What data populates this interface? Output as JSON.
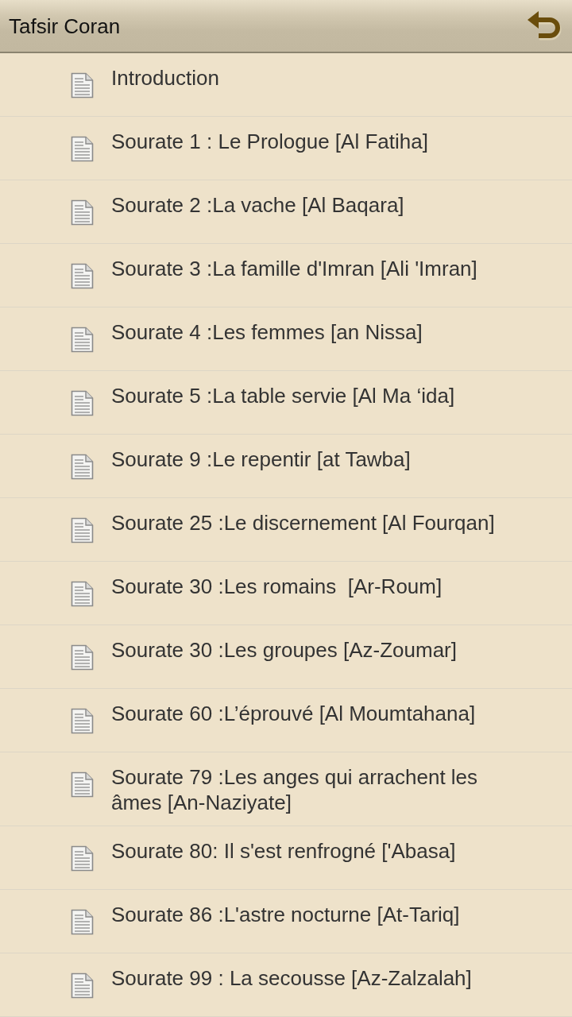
{
  "app_bar": {
    "title": "Tafsir Coran"
  },
  "items": [
    {
      "label": "Introduction"
    },
    {
      "label": "Sourate 1 : Le Prologue [Al Fatiha]"
    },
    {
      "label": "Sourate 2 :La vache [Al Baqara]"
    },
    {
      "label": "Sourate 3 :La famille d'Imran [Ali 'Imran]"
    },
    {
      "label": "Sourate 4 :Les femmes [an Nissa]"
    },
    {
      "label": "Sourate 5 :La table servie [Al Ma ‘ida]"
    },
    {
      "label": "Sourate 9 :Le repentir [at Tawba]"
    },
    {
      "label": "Sourate 25 :Le discernement [Al Fourqan]"
    },
    {
      "label": "Sourate 30 :Les romains  [Ar-Roum]"
    },
    {
      "label": "Sourate 30 :Les groupes [Az-Zoumar]"
    },
    {
      "label": "Sourate 60 :L’éprouvé [Al Moumtahana]"
    },
    {
      "label": "Sourate 79 :Les anges qui arrachent les âmes [An-Naziyate]"
    },
    {
      "label": "Sourate 80: Il s'est renfrogné ['Abasa]"
    },
    {
      "label": "Sourate 86 :L'astre nocturne [At-Tariq]"
    },
    {
      "label": "Sourate 99 : La secousse [Az-Zalzalah]"
    }
  ]
}
